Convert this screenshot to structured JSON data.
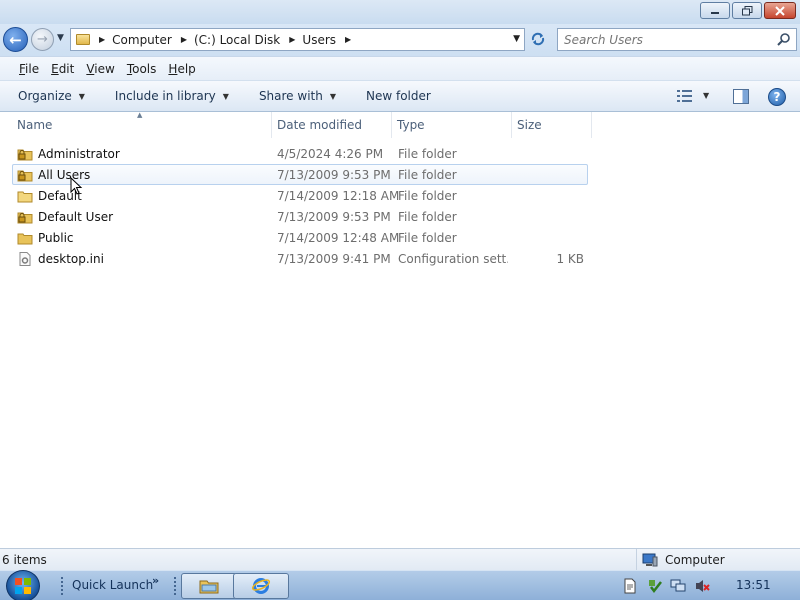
{
  "window": {
    "minimize_label": "▭",
    "maximize_label": "❐",
    "close_label": "✕"
  },
  "address": {
    "breadcrumbs": [
      "Computer",
      "(C:) Local Disk",
      "Users"
    ]
  },
  "search": {
    "placeholder": "Search Users"
  },
  "menu": {
    "items": [
      {
        "mnemonic": "F",
        "rest": "ile"
      },
      {
        "mnemonic": "E",
        "rest": "dit"
      },
      {
        "mnemonic": "V",
        "rest": "iew"
      },
      {
        "mnemonic": "T",
        "rest": "ools"
      },
      {
        "mnemonic": "H",
        "rest": "elp"
      }
    ]
  },
  "commands": {
    "organize": "Organize",
    "include_in_library": "Include in library",
    "share_with": "Share with",
    "new_folder": "New folder"
  },
  "columns": {
    "name": "Name",
    "date_modified": "Date modified",
    "type": "Type",
    "size": "Size"
  },
  "files": [
    {
      "name": "Administrator",
      "date": "4/5/2024 4:26 PM",
      "type": "File folder",
      "size": "",
      "icon": "locked-folder-icon"
    },
    {
      "name": "All Users",
      "date": "7/13/2009 9:53 PM",
      "type": "File folder",
      "size": "",
      "icon": "locked-folder-icon"
    },
    {
      "name": "Default",
      "date": "7/14/2009 12:18 AM",
      "type": "File folder",
      "size": "",
      "icon": "folder-icon"
    },
    {
      "name": "Default User",
      "date": "7/13/2009 9:53 PM",
      "type": "File folder",
      "size": "",
      "icon": "locked-folder-icon"
    },
    {
      "name": "Public",
      "date": "7/14/2009 12:48 AM",
      "type": "File folder",
      "size": "",
      "icon": "folder-icon"
    },
    {
      "name": "desktop.ini",
      "date": "7/13/2009 9:41 PM",
      "type": "Configuration sett...",
      "size": "1 KB",
      "icon": "settings-file-icon"
    }
  ],
  "status": {
    "item_count": "6 items",
    "location": "Computer"
  },
  "taskbar": {
    "quick_launch": "Quick Launch",
    "more": "»",
    "clock": "13:51"
  },
  "colors": {
    "accent": "#2560b8",
    "hover_row_border": "#b8d1ee",
    "folder": "#e8c35a"
  }
}
